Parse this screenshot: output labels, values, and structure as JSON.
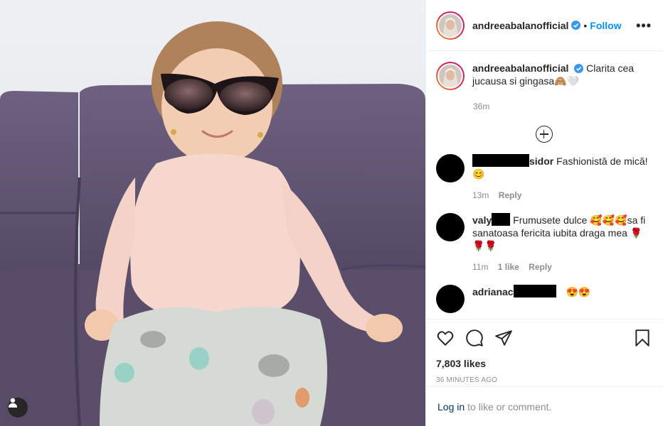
{
  "post": {
    "username": "andreeabalanofficial",
    "follow_label": "Follow",
    "separator": "•",
    "more_label": "•••"
  },
  "caption": {
    "username": "andreeabalanofficial",
    "text": "Clarita cea jucausa si gingasa🙈🤍",
    "time": "36m"
  },
  "comments": [
    {
      "username_suffix": "sidor",
      "text": "Fashionistă de mică! 😊",
      "time": "13m",
      "likes": "",
      "reply_label": "Reply"
    },
    {
      "username_prefix": "valy",
      "text": "Frumusete dulce 🥰🥰🥰sa fi sanatoasa fericita iubita draga mea 🌹🌹🌹",
      "time": "11m",
      "likes": "1 like",
      "reply_label": "Reply"
    },
    {
      "username_prefix": "adrianac",
      "text": "😍😍",
      "time": "",
      "likes": "",
      "reply_label": ""
    }
  ],
  "stats": {
    "likes": "7,803 likes",
    "ago": "36 MINUTES AGO"
  },
  "login": {
    "link": "Log in",
    "text": "to like or comment."
  },
  "icons": {
    "like": "heart-icon",
    "comment": "comment-icon",
    "share": "share-icon",
    "save": "bookmark-icon",
    "user_tag": "user-tag-icon",
    "add_comments": "plus-circle-icon",
    "verified": "verified-badge-icon"
  },
  "colors": {
    "accent": "#0095f6",
    "muted": "#8e8e8e",
    "link_dark": "#00376b",
    "sofa": "#5d4f6c"
  }
}
